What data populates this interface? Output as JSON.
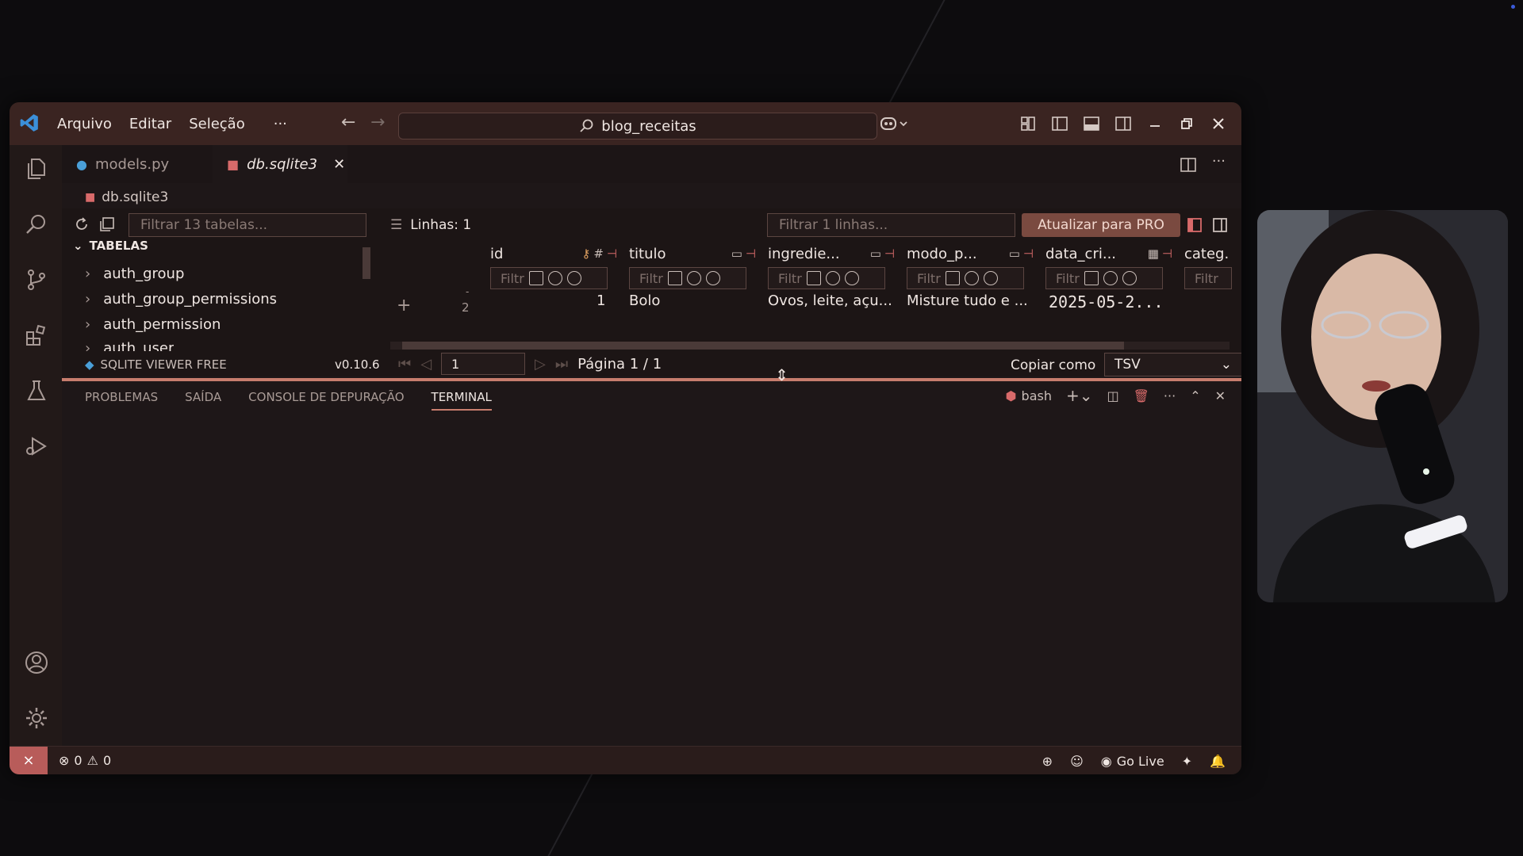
{
  "menu": {
    "arquivo": "Arquivo",
    "editar": "Editar",
    "selecao": "Seleção",
    "more": "···"
  },
  "command_center": {
    "text": "blog_receitas"
  },
  "tabs": [
    {
      "label": "models.py"
    },
    {
      "label": "db.sqlite3"
    }
  ],
  "breadcrumb": {
    "label": "db.sqlite3"
  },
  "sidebar": {
    "filter_placeholder": "Filtrar 13 tabelas...",
    "section": "TABELAS",
    "items": [
      {
        "label": "auth_group"
      },
      {
        "label": "auth_group_permissions"
      },
      {
        "label": "auth_permission"
      },
      {
        "label": "auth_user"
      }
    ]
  },
  "grid": {
    "rows_label": "Linhas: 1",
    "filter_rows_placeholder": "Filtrar 1 linhas...",
    "pro_button": "Atualizar para PRO",
    "filter_cell_placeholder": "Filtr",
    "columns": [
      {
        "name": "id"
      },
      {
        "name": "titulo"
      },
      {
        "name": "ingredie..."
      },
      {
        "name": "modo_p..."
      },
      {
        "name": "data_cri..."
      },
      {
        "name": "categ."
      }
    ],
    "row_number": "2",
    "row_marker": "-",
    "add_symbol": "+",
    "row": {
      "id": "1",
      "titulo": "Bolo",
      "ingredientes": "Ovos, leite, açu...",
      "modo_preparo": "Misture tudo e ...",
      "data_criacao": "2025-05-2..."
    }
  },
  "footer": {
    "extension_name": "SQLITE VIEWER FREE",
    "version": "v0.10.6",
    "page_input": "1",
    "page_label": "Página 1 / 1",
    "copy_label": "Copiar como",
    "copy_format": "TSV"
  },
  "panel": {
    "tabs": [
      "PROBLEMAS",
      "SAÍDA",
      "CONSOLE DE DEPURAÇÃO",
      "TERMINAL"
    ],
    "shell": "bash"
  },
  "status": {
    "errors": "0",
    "warnings": "0",
    "go_live": "Go Live"
  },
  "colors": {
    "titlebar": "#3a2421",
    "accent": "#c77d6d",
    "pro_button": "#7a4a40",
    "remote": "#b85c5a"
  }
}
